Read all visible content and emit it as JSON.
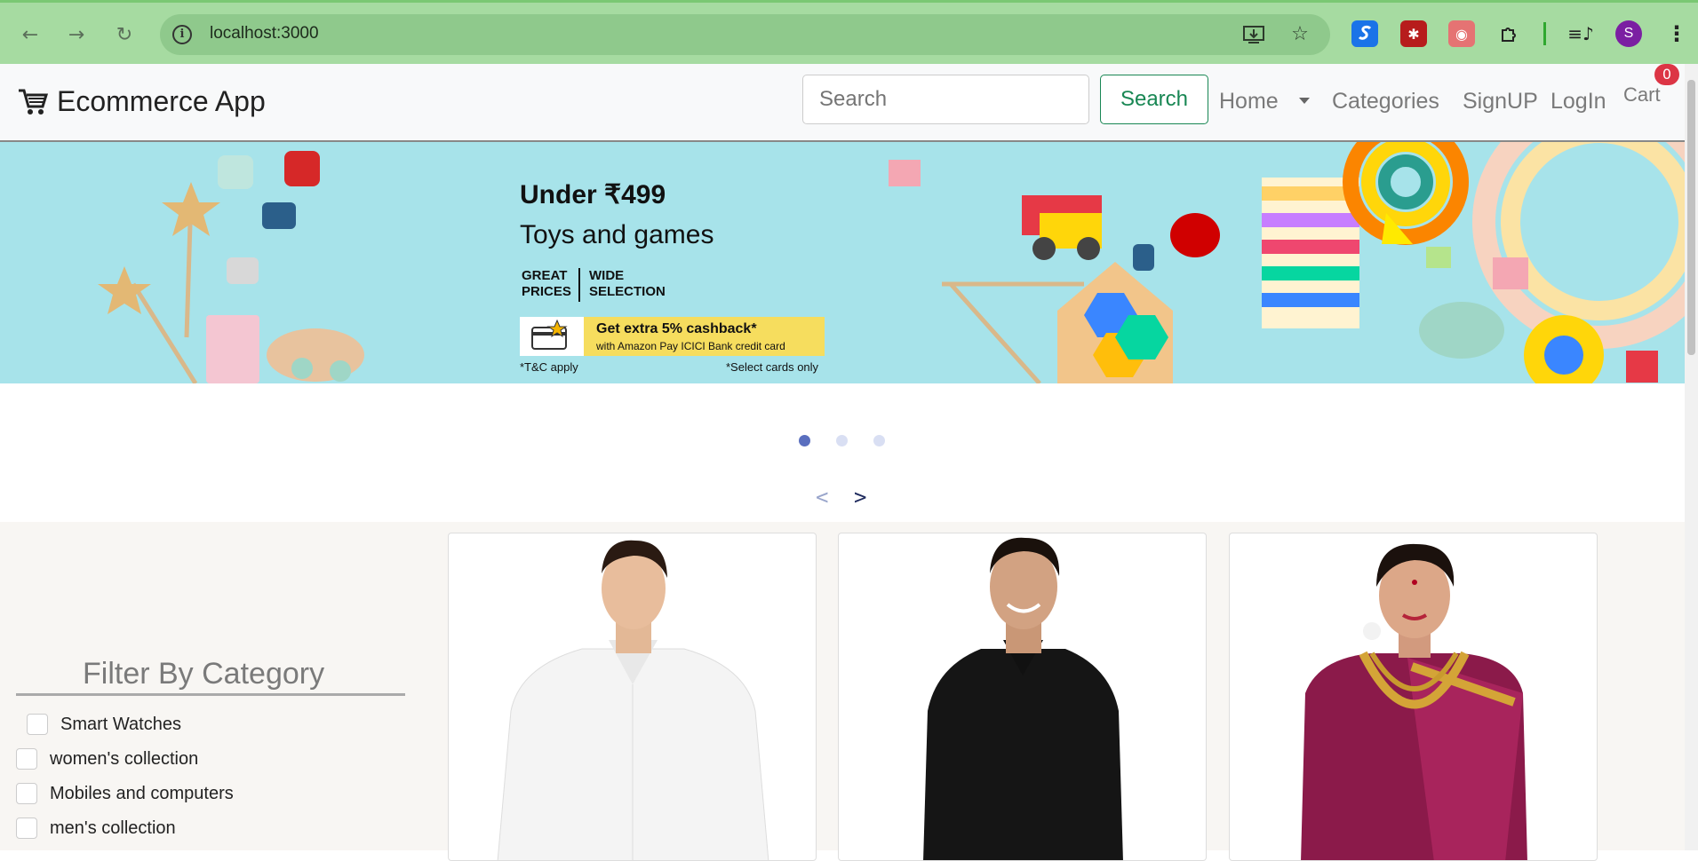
{
  "browser": {
    "url": "localhost:3000",
    "profile_initial": "S",
    "icons": [
      "back-icon",
      "forward-icon",
      "reload-icon",
      "site-info-icon",
      "install-app-icon",
      "bookmark-star-icon",
      "extensions-puzzle-icon",
      "media-playlist-icon",
      "more-menu-icon"
    ]
  },
  "navbar": {
    "brand": "Ecommerce App",
    "search_placeholder": "Search",
    "search_button": "Search",
    "links": [
      "Home",
      "Categories",
      "SignUP",
      "LogIn"
    ],
    "cart_label": "Cart",
    "cart_count": "0"
  },
  "banner": {
    "headline": "Under ₹499",
    "subheadline": "Toys and games",
    "tag_left": [
      "GREAT",
      "PRICES"
    ],
    "tag_right": [
      "WIDE",
      "SELECTION"
    ],
    "cashback_title": "Get extra 5% cashback*",
    "cashback_sub": "with Amazon Pay ICICI Bank credit card",
    "fine_left": "*T&C apply",
    "fine_right": "*Select cards only"
  },
  "carousel": {
    "dots": 3,
    "active_index": 0,
    "prev": "<",
    "next": ">"
  },
  "filter": {
    "title": "Filter By Category",
    "categories": [
      "Smart Watches",
      "women's collection",
      "Mobiles and computers",
      "men's collection"
    ]
  },
  "products": [
    {
      "image": "man-white-shirt-photo"
    },
    {
      "image": "man-black-shirt-photo"
    },
    {
      "image": "woman-saree-photo"
    }
  ],
  "colors": {
    "chrome": "#a6dba1",
    "success": "#198754",
    "badge": "#dc3545",
    "banner_bg": "#a7e3ea"
  }
}
